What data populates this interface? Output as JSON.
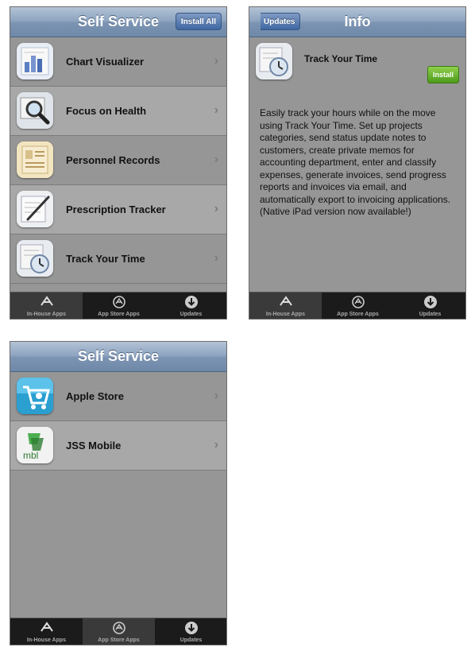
{
  "screen_a": {
    "title": "Self Service",
    "install_all": "Install All",
    "items": [
      {
        "label": "Chart Visualizer",
        "icon": "chart-icon"
      },
      {
        "label": "Focus on Health",
        "icon": "magnifier-icon"
      },
      {
        "label": "Personnel Records",
        "icon": "records-icon"
      },
      {
        "label": "Prescription Tracker",
        "icon": "prescription-icon"
      },
      {
        "label": "Track Your Time",
        "icon": "clock-icon"
      }
    ],
    "tabs": [
      "In-House Apps",
      "App Store Apps",
      "Updates"
    ]
  },
  "screen_b": {
    "back": "Updates",
    "title": "Info",
    "app_name": "Track Your Time",
    "install": "Install",
    "description": "Easily track your hours while on the move using Track Your Time. Set up projects categories, send status update notes to customers, create private memos for accounting department, enter and classify expenses, generate invoices, send progress reports and invoices via email, and automatically export to invoicing applications. (Native iPad version now available!)",
    "tabs": [
      "In-House Apps",
      "App Store Apps",
      "Updates"
    ]
  },
  "screen_c": {
    "title": "Self Service",
    "items": [
      {
        "label": "Apple Store",
        "icon": "shopping-cart-icon"
      },
      {
        "label": "JSS Mobile",
        "icon": "jss-mobile-icon"
      }
    ],
    "tabs": [
      "In-House Apps",
      "App Store Apps",
      "Updates"
    ]
  },
  "colors": {
    "navbar": "#7d95b3",
    "list_bg": "#969696",
    "row_alt": "#a8a8a8",
    "tabbar": "#1b1b1b",
    "install_green": "#5aa826"
  }
}
